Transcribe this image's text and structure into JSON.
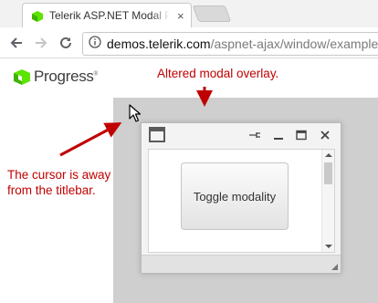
{
  "browser": {
    "tab_title": "Telerik ASP.NET Modal Popup",
    "tab_close": "×",
    "url_domain": "demos.telerik.com",
    "url_path": "/aspnet-ajax/window/examples"
  },
  "page": {
    "logo_text": "Progress",
    "logo_tm": "®"
  },
  "window": {
    "button_label": "Toggle modality"
  },
  "annotations": {
    "overlay_note": "Altered modal overlay.",
    "cursor_note": "The cursor is away from the titlebar."
  },
  "colors": {
    "annotation_red": "#c00000",
    "overlay_gray": "#cfcfcf",
    "progress_green": "#5ce500"
  },
  "icons": [
    "back-arrow-icon",
    "forward-arrow-icon",
    "reload-icon",
    "info-icon",
    "pin-icon",
    "minimize-icon",
    "maximize-icon",
    "close-icon",
    "mouse-cursor-icon"
  ]
}
